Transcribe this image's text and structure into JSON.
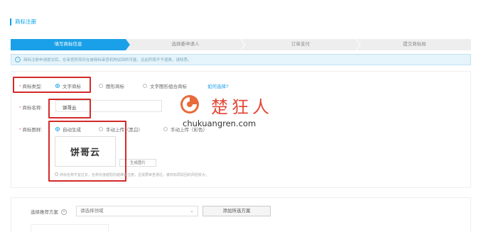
{
  "page": {
    "title": "商标注册"
  },
  "steps": [
    {
      "label": "填写商标信息",
      "active": true
    },
    {
      "label": "选择委申请人",
      "active": false
    },
    {
      "label": "订单支付",
      "active": false
    },
    {
      "label": "提交商标局",
      "active": false
    }
  ],
  "notice": {
    "text": "商标注册申请提交后，在审查阶段存在被商标审查机构驳回的可能，且此阶段不予退费，请知悉。"
  },
  "form": {
    "type_label": "商标类型:",
    "type_options": [
      "文字商标",
      "图形商标",
      "文字图形组合商标"
    ],
    "type_selected": 0,
    "type_help": "如何选择?",
    "name_label": "商标名称:",
    "name_value": "饼哥云",
    "image_label": "商标图样:",
    "image_options": [
      "自动生成",
      "手动上传（黑白）",
      "手动上传（彩色）"
    ],
    "image_selected": 0,
    "preview_text": "饼哥云",
    "generate_button": "生成图片",
    "hint": "商标名称不宜过长，名称长度越短的越难被注册，且需要审查通过，被商标局驳回的风险较大。"
  },
  "plan": {
    "label": "选择推荐方案",
    "select_placeholder": "请选择领域",
    "add_button": "添加所选方案"
  },
  "watermark": {
    "text": "楚狂人",
    "url": "chukuangren.com"
  },
  "colors": {
    "accent": "#1aa0e8",
    "highlight": "#d42a2a",
    "watermark": "#e24b3b"
  }
}
